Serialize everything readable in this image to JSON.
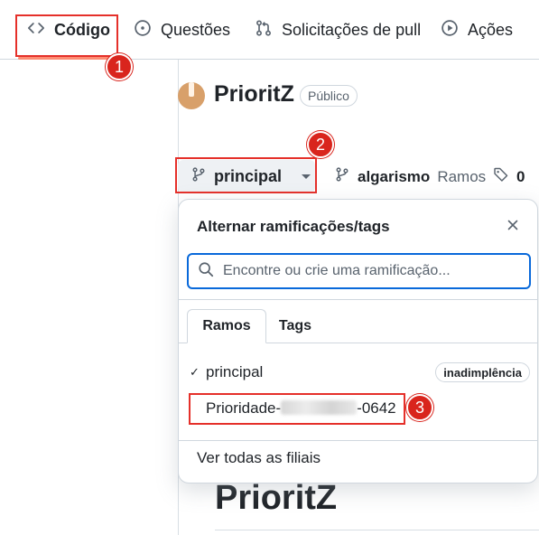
{
  "nav": {
    "code": "Código",
    "issues": "Questões",
    "pulls": "Solicitações de pull",
    "actions": "Ações"
  },
  "repo": {
    "name": "PrioritZ",
    "visibility": "Público"
  },
  "branch_bar": {
    "current_branch": "principal",
    "branches_count": "algarismo",
    "branches_label": "Ramos",
    "tags_count": "0"
  },
  "dropdown": {
    "title": "Alternar ramificações/tags",
    "search_placeholder": "Encontre ou crie uma ramificação...",
    "tabs": [
      "Ramos",
      "Tags"
    ],
    "branches": [
      {
        "name": "principal",
        "checked": true,
        "badge": "inadimplência"
      },
      {
        "name_prefix": "Prioridade-",
        "name_suffix": "-0642",
        "checked": false
      }
    ],
    "view_all": "Ver todas as filiais"
  },
  "readme": {
    "title": "PrioritZ"
  },
  "callouts": [
    "1",
    "2",
    "3"
  ],
  "colors": {
    "callout_red": "#d9251d",
    "focus_blue": "#0969da",
    "active_underline": "#fd8c73"
  },
  "icons": [
    "code-icon",
    "issue-opened-icon",
    "git-pull-request-icon",
    "play-icon",
    "git-branch-icon",
    "tag-icon",
    "close-icon",
    "search-icon",
    "check-icon"
  ]
}
